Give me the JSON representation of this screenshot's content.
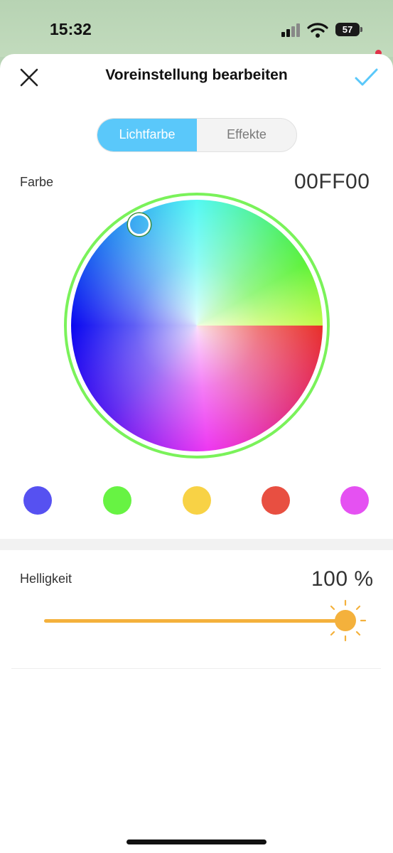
{
  "status_bar": {
    "time": "15:32",
    "battery": "57",
    "icons": [
      "signal-icon",
      "wifi-icon",
      "battery-icon"
    ]
  },
  "header": {
    "title": "Voreinstellung bearbeiten",
    "close_icon": "close-icon",
    "confirm_icon": "checkmark-icon"
  },
  "tabs": [
    {
      "label": "Lichtfarbe",
      "selected": true
    },
    {
      "label": "Effekte",
      "selected": false
    }
  ],
  "color": {
    "label": "Farbe",
    "hex": "00FF00"
  },
  "swatches": [
    {
      "name": "blue",
      "color": "#5651f1"
    },
    {
      "name": "green",
      "color": "#67f343"
    },
    {
      "name": "yellow",
      "color": "#f8d245"
    },
    {
      "name": "red",
      "color": "#e84f41"
    },
    {
      "name": "magenta",
      "color": "#e551f2"
    }
  ],
  "brightness": {
    "label": "Helligkeit",
    "value_text": "100 %",
    "level": 1.0
  },
  "colors": {
    "accent": "#5ac8fa",
    "slider": "#f4b13c"
  }
}
